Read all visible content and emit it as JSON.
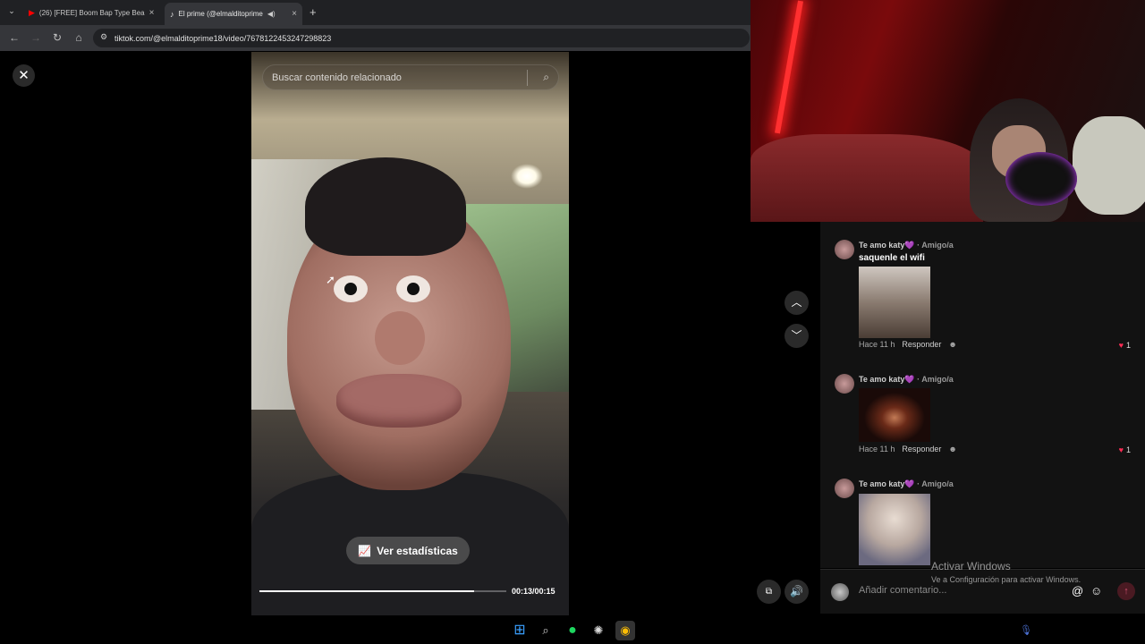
{
  "browser": {
    "tabs": [
      {
        "title": "(26) [FREE] Boom Bap Type Bea",
        "icon": "youtube-icon",
        "active": false
      },
      {
        "title": "El prime (@elmalditoprime",
        "icon": "tiktok-icon",
        "active": true
      }
    ],
    "url": "tiktok.com/@elmalditoprime18/video/7678122453247298823"
  },
  "video": {
    "search_placeholder": "Buscar contenido relacionado",
    "stats_label": "Ver estadísticas",
    "time": "00:13/00:15",
    "progress": 0.87
  },
  "comments": [
    {
      "author": "Te amo katy💜",
      "relation": "· Amigo/a",
      "text": "saquenle el wifi",
      "time": "Hace 11 h",
      "reply": "Responder",
      "likes": "1",
      "thumb_color": "#8a7b70"
    },
    {
      "author": "Te amo katy💜",
      "relation": "· Amigo/a",
      "text": "",
      "time": "Hace 11 h",
      "reply": "Responder",
      "likes": "1",
      "thumb_color": "#3a1a12"
    },
    {
      "author": "Te amo katy💜",
      "relation": "· Amigo/a",
      "text": "",
      "time": "",
      "reply": "",
      "likes": "",
      "thumb_color": "#b8a8a0"
    }
  ],
  "comment_input": {
    "placeholder": "Añadir comentario..."
  },
  "watermark": {
    "title": "Activar Windows",
    "subtitle": "Ve a Configuración para activar Windows."
  },
  "colors": {
    "like_heart": "#fe2c55",
    "browser_bg": "#202124"
  }
}
